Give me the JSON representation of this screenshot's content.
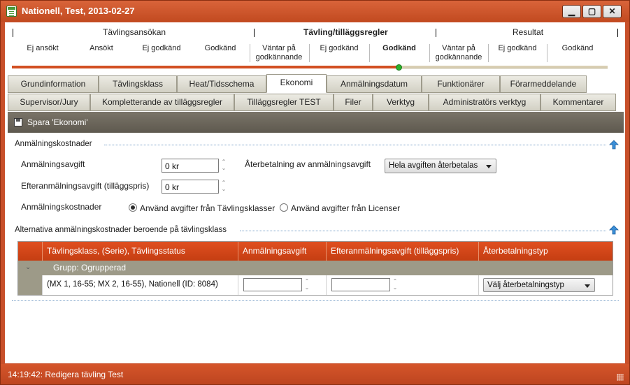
{
  "window": {
    "title": "Nationell, Test, 2013-02-27",
    "minimize_glyph": "▁",
    "maximize_glyph": "▢",
    "close_glyph": "✕"
  },
  "workflow": {
    "headers": [
      "Tävlingsansökan",
      "Tävling/tilläggsregler",
      "Resultat"
    ],
    "steps": [
      "Ej ansökt",
      "Ansökt",
      "Ej godkänd",
      "Godkänd",
      "Väntar på godkännande",
      "Ej godkänd",
      "Godkänd",
      "Väntar på godkännande",
      "Ej godkänd",
      "Godkänd"
    ],
    "progress_fraction": 0.65
  },
  "tabs_row1": [
    "Grundinformation",
    "Tävlingsklass",
    "Heat/Tidsschema",
    "Ekonomi",
    "Anmälningsdatum",
    "Funktionärer",
    "Förarmeddelande"
  ],
  "tabs_row2": [
    "Supervisor/Jury",
    "Kompletterande av tilläggsregler",
    "Tilläggsregler TEST",
    "Filer",
    "Verktyg",
    "Administratörs verktyg",
    "Kommentarer"
  ],
  "active_tab": "Ekonomi",
  "toolbar": {
    "save_label": "Spara 'Ekonomi'"
  },
  "costs_section": {
    "title": "Anmälningskostnader",
    "fee_label": "Anmälningsavgift",
    "fee_value": "0 kr",
    "late_fee_label": "Efteranmälningsavgift (tilläggspris)",
    "late_fee_value": "0 kr",
    "refund_label": "Återbetalning av anmälningsavgift",
    "refund_selected": "Hela avgiften återbetalas",
    "costs_label": "Anmälningskostnader",
    "radio_options": [
      "Använd avgifter från Tävlingsklasser",
      "Använd avgifter från Licenser"
    ],
    "radio_selected_index": 0
  },
  "alt_section": {
    "title": "Alternativa anmälningskostnader beroende på tävlingsklass",
    "columns": [
      "Tävlingsklass, (Serie), Tävlingsstatus",
      "Anmälningsavgift",
      "Efteranmälningsavgift (tilläggspris)",
      "Återbetalningstyp"
    ],
    "group_toggle": "⌄",
    "group_label": "Grupp: Ogrupperad",
    "rows": [
      {
        "class": "(MX 1, 16-55; MX 2, 16-55), Nationell (ID: 8084)",
        "fee": "",
        "late_fee": "",
        "refund_type": "Välj återbetalningstyp"
      }
    ]
  },
  "status_bar": {
    "text": "14:19:42: Redigera tävling Test"
  },
  "colors": {
    "accent": "#c8502a",
    "header_orange": "#d9491a",
    "toolbar_gray": "#6b655a",
    "progress_green": "#2db12d"
  }
}
